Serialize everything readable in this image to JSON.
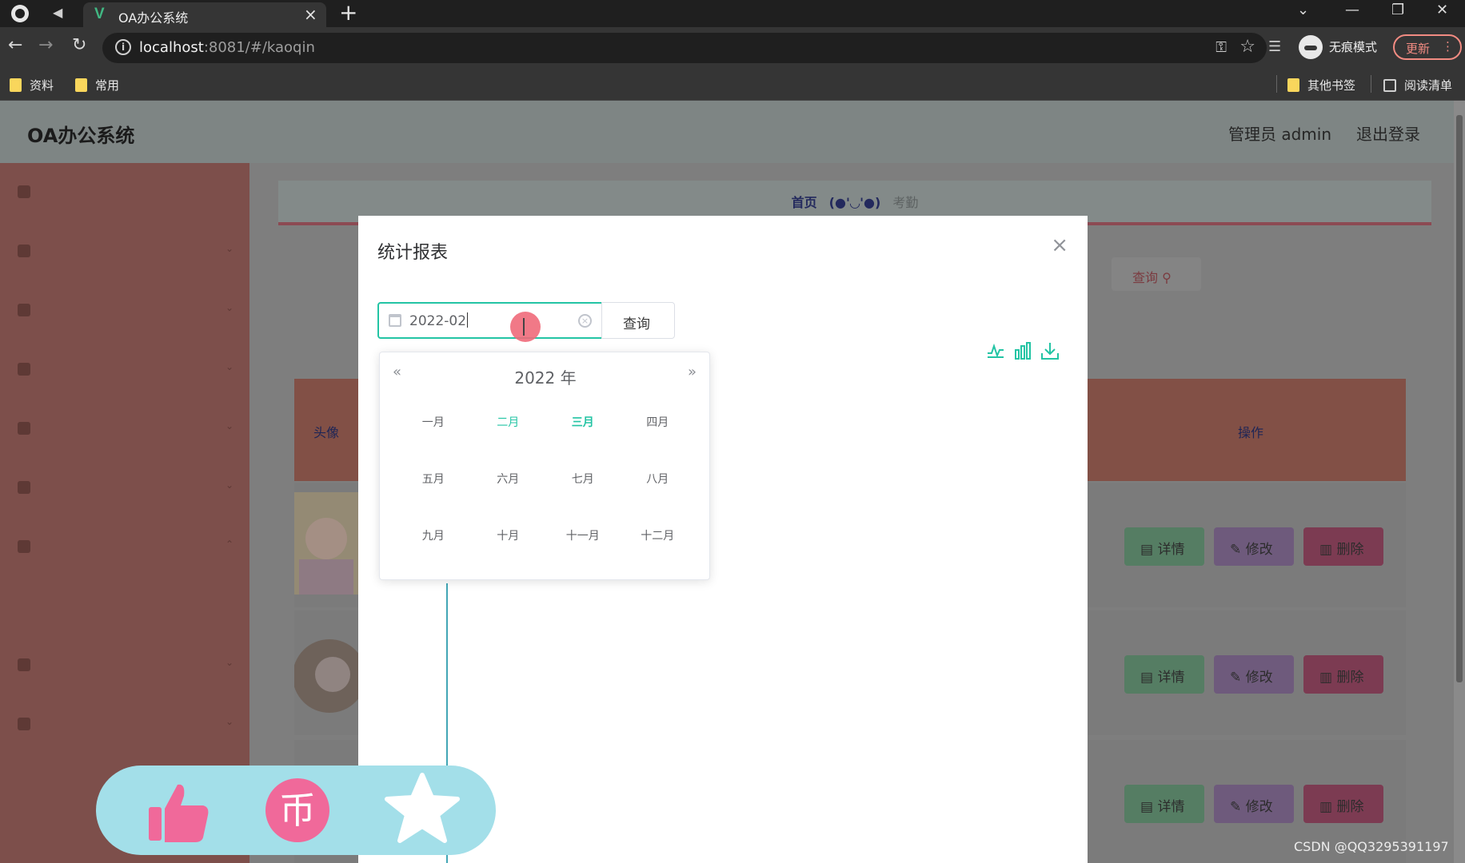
{
  "browser": {
    "tab_title": "OA办公系统",
    "url_host": "localhost",
    "url_rest": ":8081/#/kaoqin",
    "incognito_label": "无痕模式",
    "update_label": "更新",
    "bookmarks": [
      "资料",
      "常用"
    ],
    "other_bookmarks": "其他书签",
    "reading_list": "阅读清单"
  },
  "app": {
    "title": "OA办公系统",
    "admin": "管理员 admin",
    "logout": "退出登录"
  },
  "breadcrumb": {
    "home": "首页",
    "face": "(●'◡'●)",
    "current": "考勤"
  },
  "background": {
    "query_label": "查询",
    "table_headers": {
      "avatar": "头像",
      "actions": "操作"
    },
    "row_buttons": {
      "detail": "详情",
      "edit": "修改",
      "delete": "删除"
    }
  },
  "dialog": {
    "title": "统计报表",
    "date_value": "2022-02",
    "query_label": "查询",
    "picker": {
      "year_label": "2022 年",
      "months": [
        "一月",
        "二月",
        "三月",
        "四月",
        "五月",
        "六月",
        "七月",
        "八月",
        "九月",
        "十月",
        "十一月",
        "十二月"
      ],
      "selected_month": "二月",
      "current_month": "三月"
    }
  },
  "icons": {
    "tool_line": "line-chart-icon",
    "tool_bar": "bar-chart-icon",
    "tool_download": "download-icon"
  },
  "colors": {
    "accent": "#23c4a4",
    "social_bar": "#a3dfe9",
    "like": "#f0699a"
  },
  "watermark": "CSDN @QQ3295391197"
}
